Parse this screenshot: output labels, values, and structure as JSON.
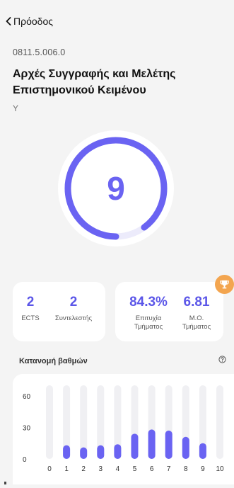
{
  "nav": {
    "back_label": "Πρόοδος"
  },
  "course": {
    "code": "0811.5.006.0",
    "title_line1": "Αρχές Συγγραφής και Μελέτης",
    "title_line2": "Επιστημονικού Κειμένου",
    "type": "Υ"
  },
  "grade": {
    "value": "9",
    "fraction": 0.9
  },
  "stats_left": [
    {
      "value": "2",
      "label": "ECTS"
    },
    {
      "value": "2",
      "label": "Συντελεστής"
    }
  ],
  "stats_right": [
    {
      "value": "84.3%",
      "label_line1": "Επιτυχία",
      "label_line2": "Τμήματος"
    },
    {
      "value": "6.81",
      "label_line1": "Μ.Ο.",
      "label_line2": "Τμήματος"
    }
  ],
  "distribution": {
    "title": "Κατανομή βαθμών"
  },
  "chart_data": {
    "type": "bar",
    "categories": [
      "0",
      "1",
      "2",
      "3",
      "4",
      "5",
      "6",
      "7",
      "8",
      "9",
      "10"
    ],
    "values": [
      0,
      13,
      11,
      13,
      14,
      24,
      28,
      27,
      21,
      15,
      0
    ],
    "ylim": [
      0,
      70
    ],
    "yticks": [
      "0",
      "30",
      "60"
    ],
    "colors": {
      "bar": "#6a63f2",
      "track": "#f0f0f3"
    }
  }
}
